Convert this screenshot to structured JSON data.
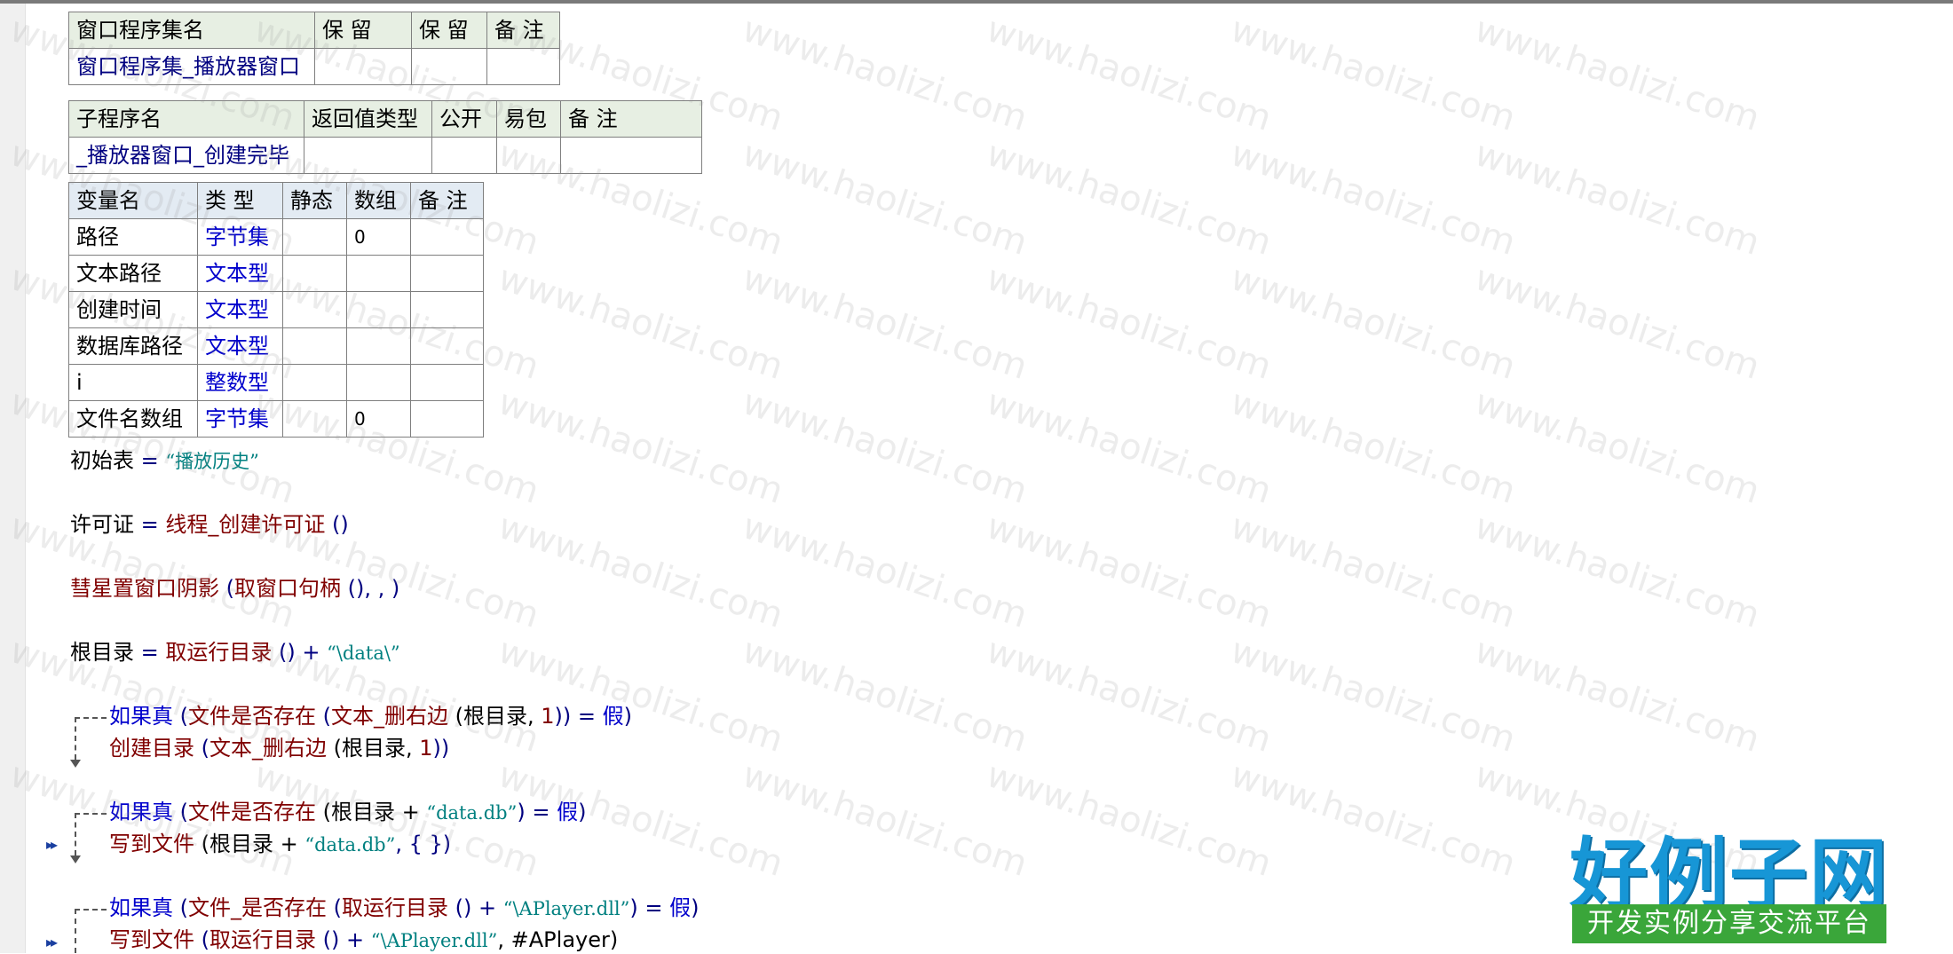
{
  "assembly_table": {
    "headers": [
      "窗口程序集名",
      "保 留",
      "保 留",
      "备 注"
    ],
    "row": [
      "窗口程序集_播放器窗口",
      "",
      "",
      ""
    ]
  },
  "sub_table": {
    "headers": [
      "子程序名",
      "返回值类型",
      "公开",
      "易包",
      "备 注"
    ],
    "row": [
      "_播放器窗口_创建完毕",
      "",
      "",
      "",
      ""
    ]
  },
  "var_table": {
    "headers": [
      "变量名",
      "类 型",
      "静态",
      "数组",
      "备 注"
    ],
    "rows": [
      {
        "name": "路径",
        "type": "字节集",
        "static": "",
        "array": "0",
        "note": ""
      },
      {
        "name": "文本路径",
        "type": "文本型",
        "static": "",
        "array": "",
        "note": ""
      },
      {
        "name": "创建时间",
        "type": "文本型",
        "static": "",
        "array": "",
        "note": ""
      },
      {
        "name": "数据库路径",
        "type": "文本型",
        "static": "",
        "array": "",
        "note": ""
      },
      {
        "name": "i",
        "type": "整数型",
        "static": "",
        "array": "",
        "note": ""
      },
      {
        "name": "文件名数组",
        "type": "字节集",
        "static": "",
        "array": "0",
        "note": ""
      }
    ]
  },
  "code": {
    "line1": {
      "a": "初始表",
      "b": " = ",
      "c": "“播放历史”"
    },
    "line2": {
      "a": "许可证",
      "b": " = ",
      "c": "线程_创建许可证",
      "d": " ()"
    },
    "line3": {
      "a": "彗星置窗口阴影",
      "b": " (",
      "c": "取窗口句柄",
      "d": " (), , )"
    },
    "line4": {
      "a": "根目录",
      "b": " = ",
      "c": "取运行目录",
      "d": " () + ",
      "e": "“\\data\\”"
    },
    "if1": {
      "kw": "如果真",
      "b": " (",
      "c": "文件是否存在",
      "d": " (",
      "e": "文本_删右边",
      "f": " (根目录, ",
      "g": "1",
      "h": ")) = ",
      "i": "假",
      "j": ")"
    },
    "if1_body": {
      "a": "创建目录",
      "b": " (",
      "c": "文本_删右边",
      "d": " (根目录, ",
      "e": "1",
      "f": "))"
    },
    "if2": {
      "kw": "如果真",
      "b": " (",
      "c": "文件是否存在",
      "d": " (根目录 + ",
      "e": "“data.db”",
      "f": ") = ",
      "g": "假",
      "h": ")"
    },
    "if2_body": {
      "a": "写到文件",
      "b": " (根目录 + ",
      "c": "“data.db”",
      "d": ", {  })"
    },
    "if3": {
      "kw": "如果真",
      "b": " (",
      "c": "文件_是否存在",
      "d": " (",
      "e": "取运行目录",
      "f": " () + ",
      "g": "“\\APlayer.dll”",
      "h": ") = ",
      "i": "假",
      "j": ")"
    },
    "if3_body": {
      "a": "写到文件",
      "b": " (",
      "c": "取运行目录",
      "d": " () + ",
      "e": "“\\APlayer.dll”",
      "f": ", #APlayer)"
    }
  },
  "brand": {
    "title": "好例子网",
    "subtitle": "开发实例分享交流平台",
    "watermark": "www.haolizi.com"
  },
  "colors": {
    "keyword": "#0000cc",
    "function": "#800000",
    "string": "#008080",
    "brand_blue": "#1796d6",
    "brand_green": "#3aa63a"
  }
}
